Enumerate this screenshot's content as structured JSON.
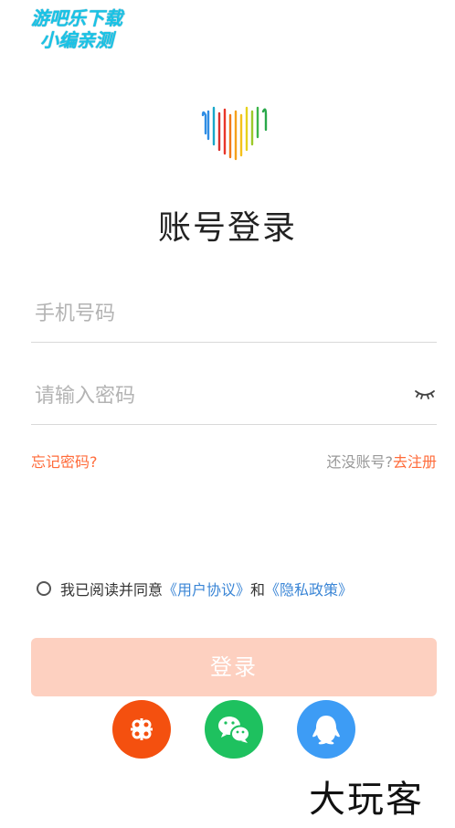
{
  "watermark_top": {
    "line1": "游吧乐下载",
    "line2": "小编亲测"
  },
  "title": "账号登录",
  "phone_input": {
    "placeholder": "手机号码",
    "value": ""
  },
  "password_input": {
    "placeholder": "请输入密码",
    "value": ""
  },
  "forgot_password": "忘记密码?",
  "no_account": {
    "text": "还没账号?",
    "register": "去注册"
  },
  "agreement": {
    "prefix": "我已阅读并同意",
    "user_agreement": "《用户协议》",
    "and": "和",
    "privacy_policy": "《隐私政策》"
  },
  "login_button": "登录",
  "social_logins": [
    {
      "icon": "unicom-icon",
      "color": "#f4500f"
    },
    {
      "icon": "wechat-icon",
      "color": "#1ec15f"
    },
    {
      "icon": "qq-icon",
      "color": "#3d9cf5"
    }
  ],
  "watermark_bottom": "大玩客",
  "colors": {
    "accent": "#ff6b3a",
    "link": "#3b86d6",
    "button_bg": "#fdd0c0"
  }
}
